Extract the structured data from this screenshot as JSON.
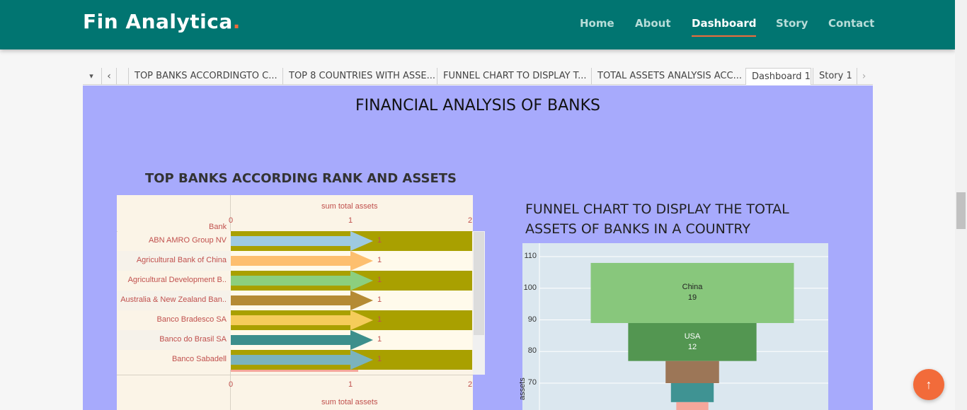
{
  "nav": {
    "brand": "Fin Analytica",
    "brand_dot": ".",
    "items": [
      "Home",
      "About",
      "Dashboard",
      "Story",
      "Contact"
    ],
    "active": "Dashboard",
    "accent": "#f26b3a",
    "bg": "#017571"
  },
  "tabs": {
    "items": [
      "TOP BANKS ACCORDINGTO C...",
      "TOP 8 COUNTRIES WITH ASSE...",
      "FUNNEL CHART TO DISPLAY T...",
      "TOTAL ASSETS ANALYSIS ACC...",
      "Dashboard 1",
      "Story 1"
    ],
    "selected": "Dashboard 1",
    "dropdown_icon": "▾",
    "prev_icon": "‹",
    "next_icon": "›"
  },
  "dashboard": {
    "title": "FINANCIAL ANALYSIS OF BANKS"
  },
  "chart_data": [
    {
      "type": "bar",
      "title": "TOP BANKS ACCORDING RANK AND ASSETS",
      "row_header": "Bank",
      "xlabel": "sum total assets",
      "xlim": [
        0,
        2
      ],
      "xticks": [
        "0",
        "1",
        "2"
      ],
      "categories": [
        "ABN AMRO Group NV",
        "Agricultural Bank of China",
        "Agricultural Development B..",
        "Australia & New Zealand Ban..",
        "Banco Bradesco SA",
        "Banco do Brasil SA",
        "Banco Sabadell"
      ],
      "values": [
        1,
        1,
        1,
        1,
        1,
        1,
        1
      ],
      "value_labels": [
        "1",
        "1",
        "1",
        "1",
        "1",
        "1",
        "1"
      ],
      "colors": [
        "#9ecae1",
        "#fdbf6f",
        "#8ccf7e",
        "#b58b34",
        "#f5cc5a",
        "#3c8f8c",
        "#7bb3bd"
      ]
    },
    {
      "type": "bar",
      "subtype": "funnel",
      "title": "FUNNEL CHART TO DISPLAY THE TOTAL ASSETS OF BANKS IN A COUNTRY",
      "ylabel": "assets",
      "ylim": [
        63,
        112
      ],
      "yticks": [
        "110",
        "100",
        "90",
        "80",
        "70"
      ],
      "categories": [
        "China",
        "USA",
        "",
        "",
        ""
      ],
      "values": [
        19,
        12,
        5,
        4,
        3
      ],
      "value_labels": [
        "19",
        "12"
      ],
      "colors": [
        "#88c77c",
        "#539651",
        "#9c7657",
        "#3f9393",
        "#f5a79b"
      ]
    }
  ],
  "fab": {
    "icon": "↑"
  }
}
